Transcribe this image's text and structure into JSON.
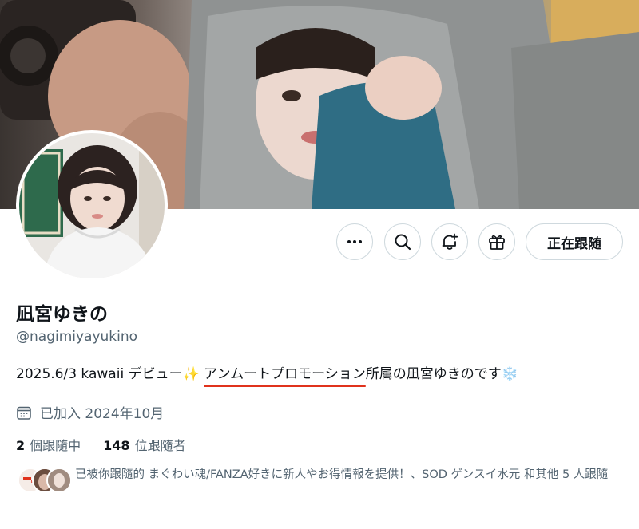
{
  "profile": {
    "display_name": "凪宮ゆきの",
    "handle": "@nagimiyayukino",
    "bio_before": "2025.6/3 kawaii デビュー",
    "bio_sparkle_emoji": "✨",
    "bio_highlight": "アンムートプロモーション",
    "bio_after": "所属の凪宮ゆきのです",
    "bio_snow_emoji": "❄️",
    "joined": "已加入 2024年10月",
    "highlight_color": "#e0321c"
  },
  "actions": {
    "more_icon": "more-horizontal-icon",
    "search_icon": "search-icon",
    "notify_icon": "bell-plus-icon",
    "gift_icon": "gift-icon",
    "follow_label": "正在跟随"
  },
  "stats": {
    "following_count": "2",
    "following_label": "個跟隨中",
    "followers_count": "148",
    "followers_label": "位跟隨者"
  },
  "followers_you_know": {
    "text": "已被你跟隨的 まぐわい魂/FANZA好きに新人やお得情報を提供！、SOD ゲンスイ水元 和其他 5 人跟隨"
  },
  "colors": {
    "text_primary": "#0f1419",
    "text_secondary": "#536471",
    "border": "#cfd9de"
  }
}
